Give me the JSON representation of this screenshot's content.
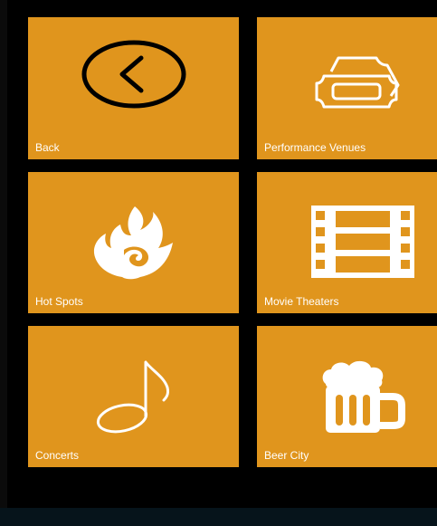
{
  "tiles": {
    "back": {
      "label": "Back",
      "icon": "back-circle-icon"
    },
    "performance_venues": {
      "label": "Performance Venues",
      "icon": "ticket-icon"
    },
    "hot_spots": {
      "label": "Hot Spots",
      "icon": "flame-icon"
    },
    "movie_theaters": {
      "label": "Movie Theaters",
      "icon": "film-strip-icon"
    },
    "concerts": {
      "label": "Concerts",
      "icon": "music-note-icon"
    },
    "beer_city": {
      "label": "Beer City",
      "icon": "beer-mug-icon"
    }
  },
  "colors": {
    "tile_background": "#e0951d",
    "screen_background": "#000000",
    "app_bar": "#06141b",
    "foreground": "#ffffff"
  }
}
